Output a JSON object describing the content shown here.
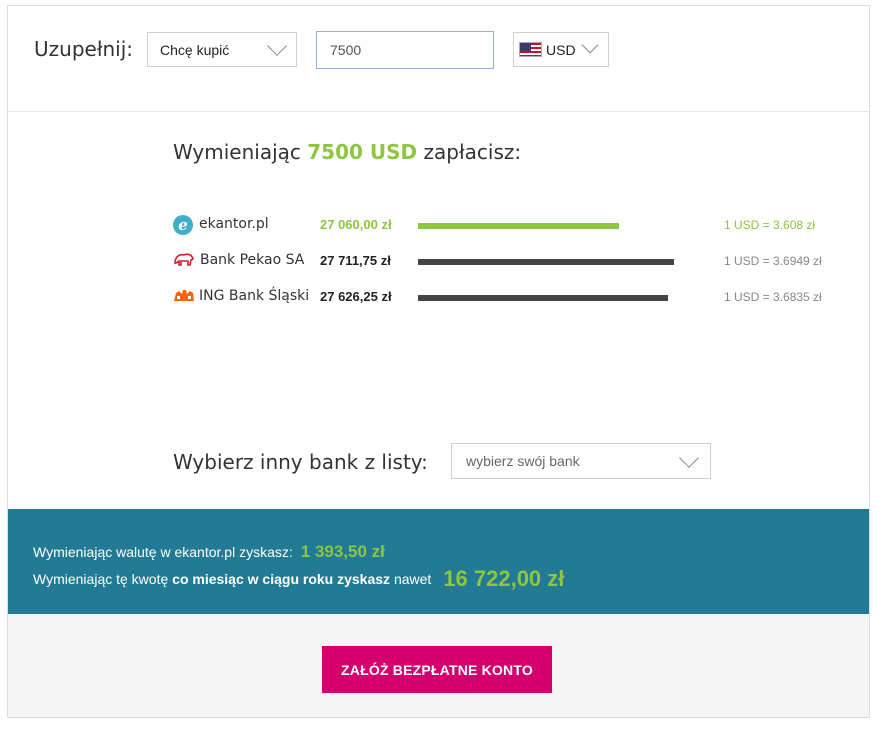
{
  "form": {
    "label": "Uzupełnij:",
    "action_select": "Chcę kupić",
    "amount_value": "7500",
    "currency_select": "USD",
    "currency_flag_icon": "us-flag-icon"
  },
  "comparison": {
    "heading_prefix": "Wymieniając",
    "heading_amount": "7500 USD",
    "heading_suffix": "zapłacisz:",
    "rows": [
      {
        "bank": "ekantor.pl",
        "price": "27 060,00 zł",
        "rate": "1 USD = 3.608 zł",
        "icon": "ekantor-logo-icon",
        "highlight": true,
        "bar_fraction": 0.785
      },
      {
        "bank": "Bank Pekao SA",
        "price": "27 711,75 zł",
        "rate": "1 USD = 3.6949 zł",
        "icon": "pekao-logo-icon",
        "highlight": false,
        "bar_fraction": 1.0
      },
      {
        "bank": "ING Bank Śląski",
        "price": "27 626,25 zł",
        "rate": "1 USD = 3.6835 zł",
        "icon": "ing-logo-icon",
        "highlight": false,
        "bar_fraction": 0.978
      }
    ]
  },
  "bank_choice": {
    "label": "Wybierz inny bank z listy:",
    "placeholder": "wybierz swój bank"
  },
  "savings": {
    "line1_text": "Wymieniając walutę w ekantor.pl zyskasz:",
    "line1_value": "1 393,50 zł",
    "line2_prefix": "Wymieniając tę kwotę",
    "line2_bold": "co miesiąc w ciągu roku zyskasz",
    "line2_suffix": "nawet",
    "line2_value": "16 722,00 zł"
  },
  "cta": {
    "label": "ZAŁÓŻ BEZPŁATNE KONTO"
  },
  "colors": {
    "accent_green": "#8dc63f",
    "band_teal": "#227a94",
    "cta_magenta": "#d4006e"
  }
}
